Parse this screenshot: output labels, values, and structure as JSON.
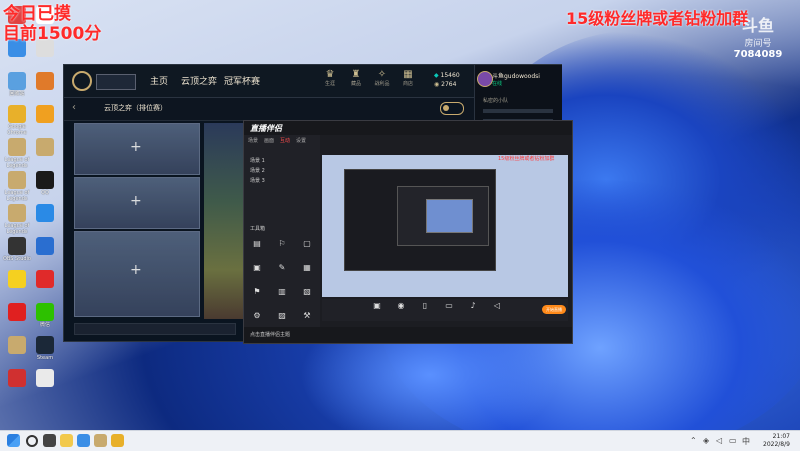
{
  "overlay": {
    "left_line1": "今日已摸",
    "left_line2": "目前1500分",
    "right_text": "15级粉丝牌或者钻粉加群",
    "watermark_brand": "斗鱼",
    "watermark_sub": "房间号",
    "watermark_id": "7084089"
  },
  "desktop_icons": [
    {
      "label": "",
      "color": "#e04040"
    },
    {
      "label": "",
      "color": "#ffffff"
    },
    {
      "label": "",
      "color": "#3a8ee6"
    },
    {
      "label": "",
      "color": "#dddddd"
    },
    {
      "label": "回收站",
      "color": "#5aa0e0"
    },
    {
      "label": "",
      "color": "#e07a2a"
    },
    {
      "label": "Google Chrome",
      "color": "#e8b02a"
    },
    {
      "label": "",
      "color": "#f0a020"
    },
    {
      "label": "League of Legends",
      "color": "#c8aa6e"
    },
    {
      "label": "",
      "color": "#c8aa6e"
    },
    {
      "label": "League of Legends",
      "color": "#c8aa6e"
    },
    {
      "label": "QQ",
      "color": "#1a1a1a"
    },
    {
      "label": "League of Legends",
      "color": "#c8aa6e"
    },
    {
      "label": "",
      "color": "#2a8ae6"
    },
    {
      "label": "OBS Studio",
      "color": "#333333"
    },
    {
      "label": "",
      "color": "#2a6ed0"
    },
    {
      "label": "",
      "color": "#f5d020"
    },
    {
      "label": "",
      "color": "#e02a2a"
    },
    {
      "label": "",
      "color": "#e02020"
    },
    {
      "label": "微信",
      "color": "#2dc100"
    },
    {
      "label": "",
      "color": "#c8aa6e"
    },
    {
      "label": "Steam",
      "color": "#1b2838"
    },
    {
      "label": "",
      "color": "#d03030"
    },
    {
      "label": "",
      "color": "#eaeaea"
    }
  ],
  "lol": {
    "play_label": "",
    "nav": [
      "主页",
      "云顶之弈",
      "冠军杯赛"
    ],
    "tools": [
      {
        "icon": "♛",
        "label": "生涯"
      },
      {
        "icon": "♜",
        "label": "藏品"
      },
      {
        "icon": "✧",
        "label": "战利品"
      },
      {
        "icon": "▦",
        "label": "商店"
      }
    ],
    "currency_be": "15460",
    "currency_rp": "2764",
    "mode_title": "云顶之弈（排位赛）",
    "username": "斗鱼gudowoodsi",
    "status": "在线",
    "social_groups": [
      "私密的小队",
      "",
      "",
      "",
      ""
    ]
  },
  "companion": {
    "brand": "直播伴侣",
    "tabs": [
      "场景",
      "画面",
      "互动",
      "设置"
    ],
    "scenes": [
      "场景 1",
      "场景 2",
      "场景 3"
    ],
    "tools_header": "工具箱",
    "tools": [
      "",
      "",
      "",
      "",
      "",
      "",
      "",
      "",
      "",
      "",
      "",
      ""
    ],
    "preview_red_text": "15级粉丝牌或者钻粉加群",
    "bottom_buttons": [
      "",
      "",
      "",
      "",
      "",
      ""
    ],
    "start_label": "开始直播",
    "footer_tip": "点击直播伴侣主题"
  },
  "taskbar": {
    "time": "21:07",
    "date": "2022/8/9"
  }
}
